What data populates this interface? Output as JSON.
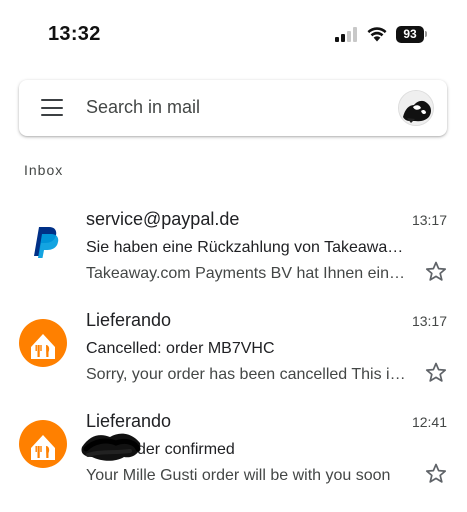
{
  "status_bar": {
    "time": "13:32",
    "battery": "93",
    "icons": [
      "signal-icon",
      "wifi-icon",
      "battery-icon"
    ]
  },
  "search": {
    "placeholder": "Search in mail",
    "icons": [
      "menu-icon",
      "account-avatar"
    ]
  },
  "section": {
    "label": "Inbox"
  },
  "colors": {
    "lieferando_orange": "#ff8000",
    "paypal_dark_blue": "#003087",
    "paypal_light_blue": "#009cde",
    "star_gray": "#5f6368"
  },
  "emails": [
    {
      "sender": "service@paypal.de",
      "time": "13:17",
      "subject": "Sie haben eine Rückzahlung von Takeaway.com Payments BV erhalten",
      "snippet": "Takeaway.com Payments BV hat Ihnen eine Rückzahlung gesendet",
      "icon": "paypal-logo-icon",
      "starred": false
    },
    {
      "sender": "Lieferando",
      "time": "13:17",
      "subject": "Cancelled: order MB7VHC",
      "snippet": "Sorry, your order has been cancelled This is to confirm",
      "icon": "lieferando-logo-icon",
      "starred": false
    },
    {
      "sender": "Lieferando",
      "time": "12:41",
      "subject": "Your order confirmed",
      "snippet": "Your Mille Gusti order will be with you soon",
      "icon": "lieferando-logo-icon",
      "starred": false
    }
  ]
}
